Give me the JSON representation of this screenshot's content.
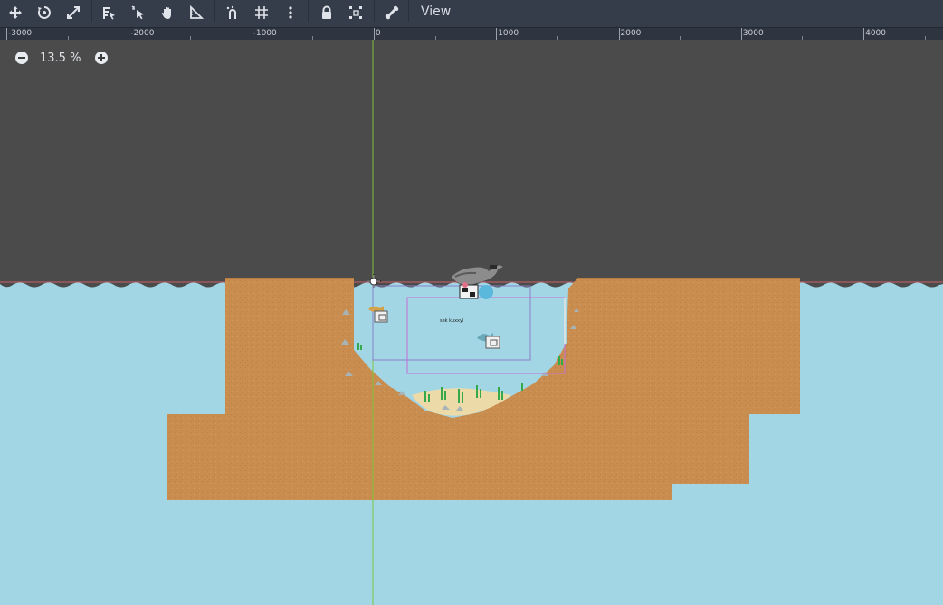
{
  "toolbar": {
    "tools": [
      "move-icon",
      "rotate-icon",
      "scale-icon",
      "list-select-icon",
      "select-icon",
      "pan-icon",
      "ruler-icon",
      "smart-snap-icon",
      "grid-snap-icon",
      "more-options-icon",
      "lock-icon",
      "group-icon",
      "bone-icon"
    ],
    "view_menu_label": "View"
  },
  "ruler": {
    "labels": [
      "-3000",
      "-2000",
      "-1000",
      "0",
      "1000",
      "2000",
      "3000",
      "4000"
    ]
  },
  "zoom": {
    "level": "13.5 %"
  },
  "scene": {
    "sign_text": "sek kuxxyl",
    "colors": {
      "background": "#4b4b4b",
      "water": "#a2d6e5",
      "ground": "#c98d4f",
      "sand": "#ecdba8",
      "origin_axis": "#7cc43a",
      "water_line": "#c8626a"
    }
  }
}
